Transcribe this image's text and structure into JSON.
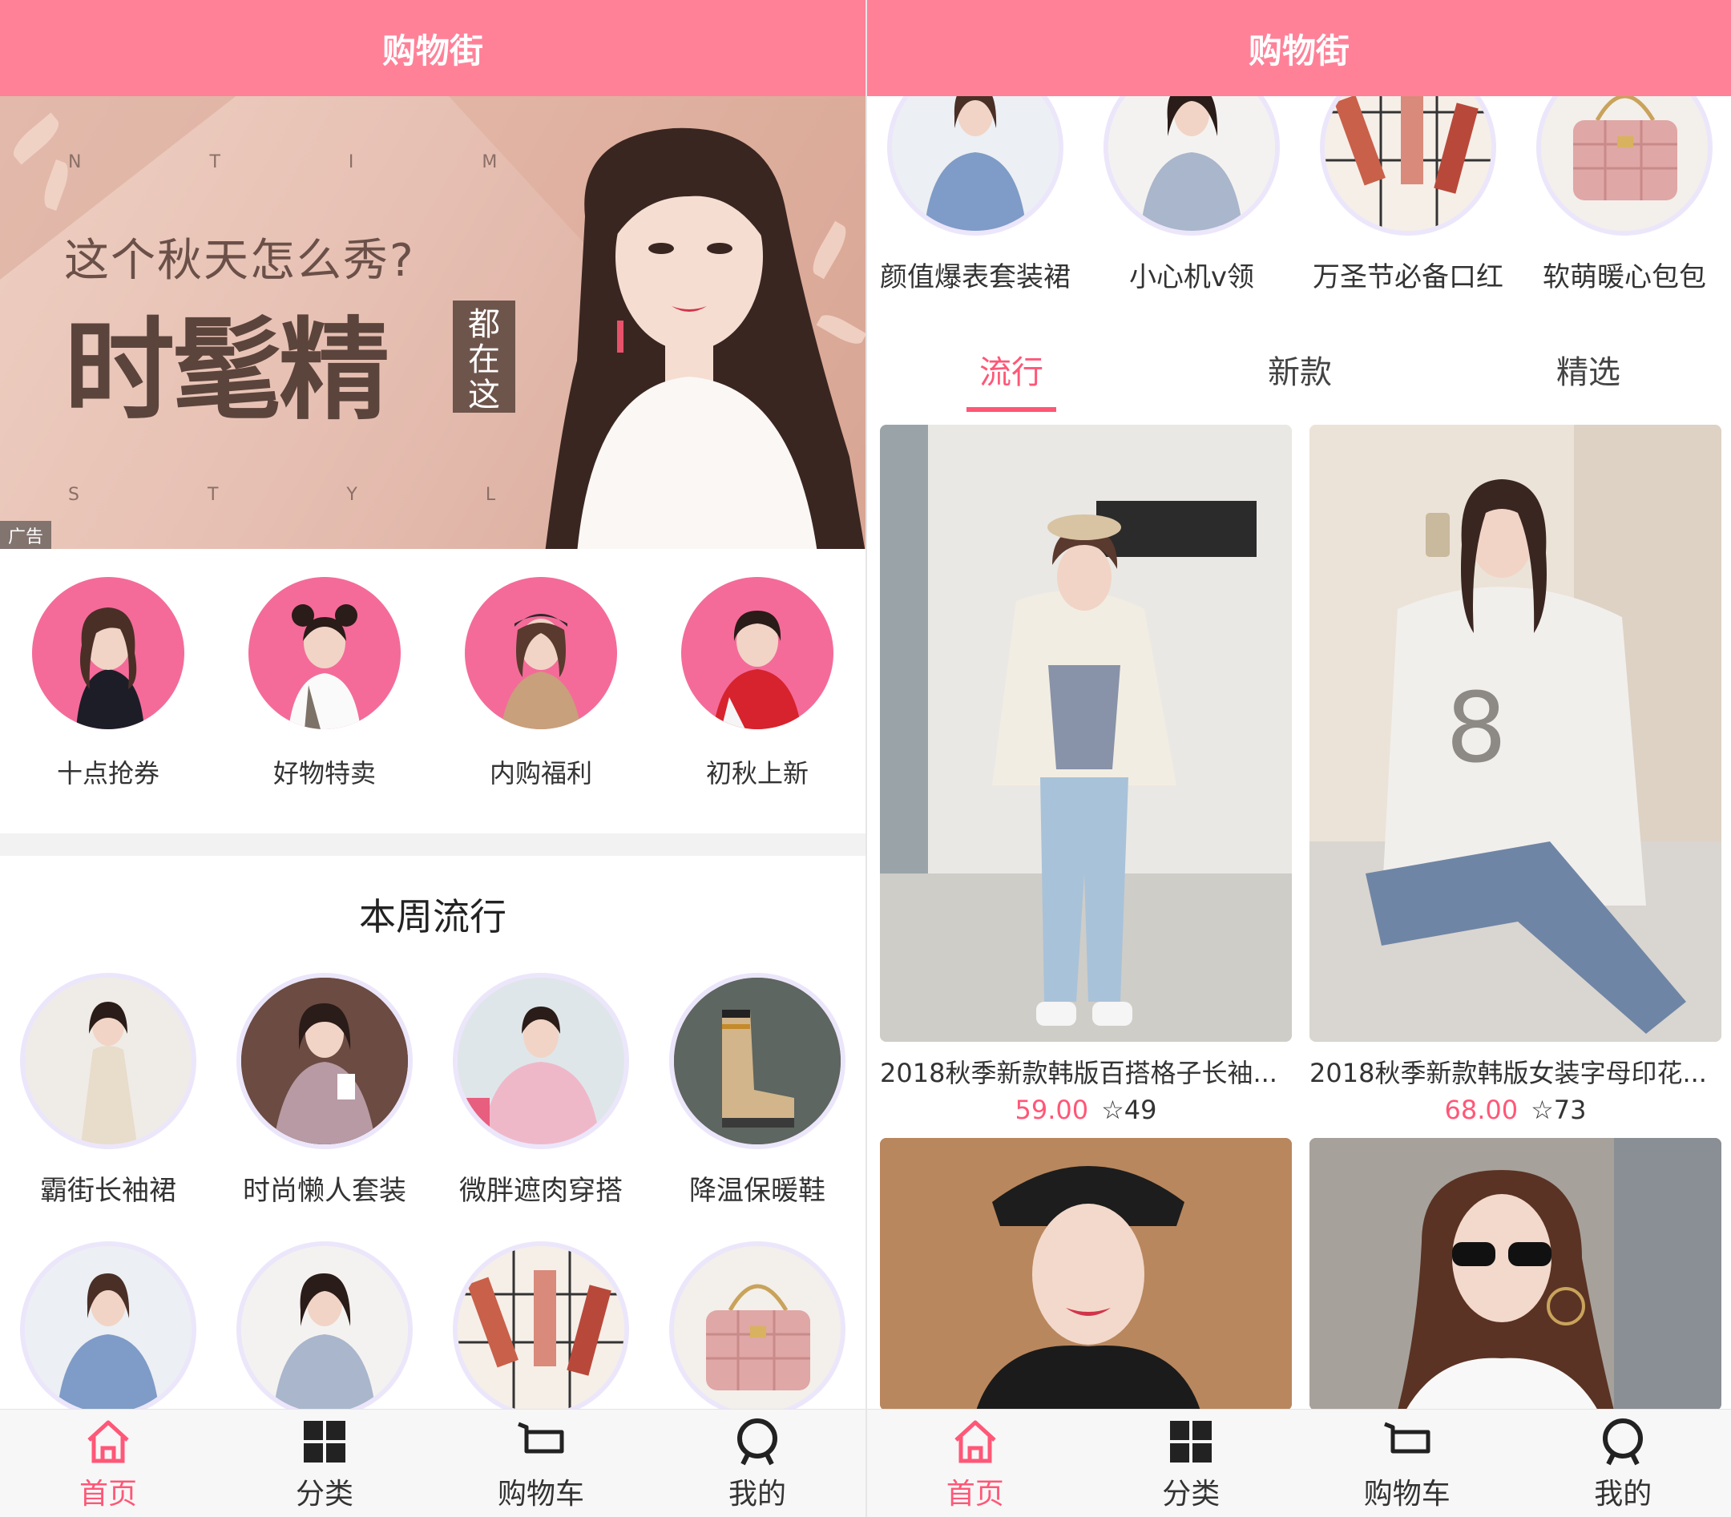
{
  "left": {
    "nav_title": "购物街",
    "banner": {
      "headline_small": "这个秋天怎么秀?",
      "headline_big": "时髦精",
      "tag": "都在这",
      "letters_top": "NTIM",
      "letters_bottom": "STYL",
      "ad_label": "广告",
      "active_dot": 2
    },
    "categories": [
      {
        "label": "十点抢券"
      },
      {
        "label": "好物特卖"
      },
      {
        "label": "内购福利"
      },
      {
        "label": "初秋上新"
      }
    ],
    "section_title": "本周流行",
    "weekly_row1": [
      {
        "label": "霸街长袖裙"
      },
      {
        "label": "时尚懒人套装"
      },
      {
        "label": "微胖遮肉穿搭"
      },
      {
        "label": "降温保暖鞋"
      }
    ]
  },
  "right": {
    "nav_title": "购物街",
    "weekly_row2": [
      {
        "label": "颜值爆表套装裙"
      },
      {
        "label": "小心机v领"
      },
      {
        "label": "万圣节必备口红"
      },
      {
        "label": "软萌暖心包包"
      }
    ],
    "filters": [
      "流行",
      "新款",
      "精选"
    ],
    "active_filter": "流行",
    "products": [
      {
        "title": "2018秋季新款韩版百搭格子长袖...",
        "price": "59.00",
        "favorites": "49"
      },
      {
        "title": "2018秋季新款韩版女装字母印花...",
        "price": "68.00",
        "favorites": "73"
      }
    ]
  },
  "tabbar": [
    {
      "label": "首页",
      "icon": "home-icon"
    },
    {
      "label": "分类",
      "icon": "grid-icon"
    },
    {
      "label": "购物车",
      "icon": "cart-icon"
    },
    {
      "label": "我的",
      "icon": "profile-icon"
    }
  ],
  "colors": {
    "brand": "#ff8198",
    "accent": "#ff5777",
    "category_bg": "#f46b99"
  }
}
